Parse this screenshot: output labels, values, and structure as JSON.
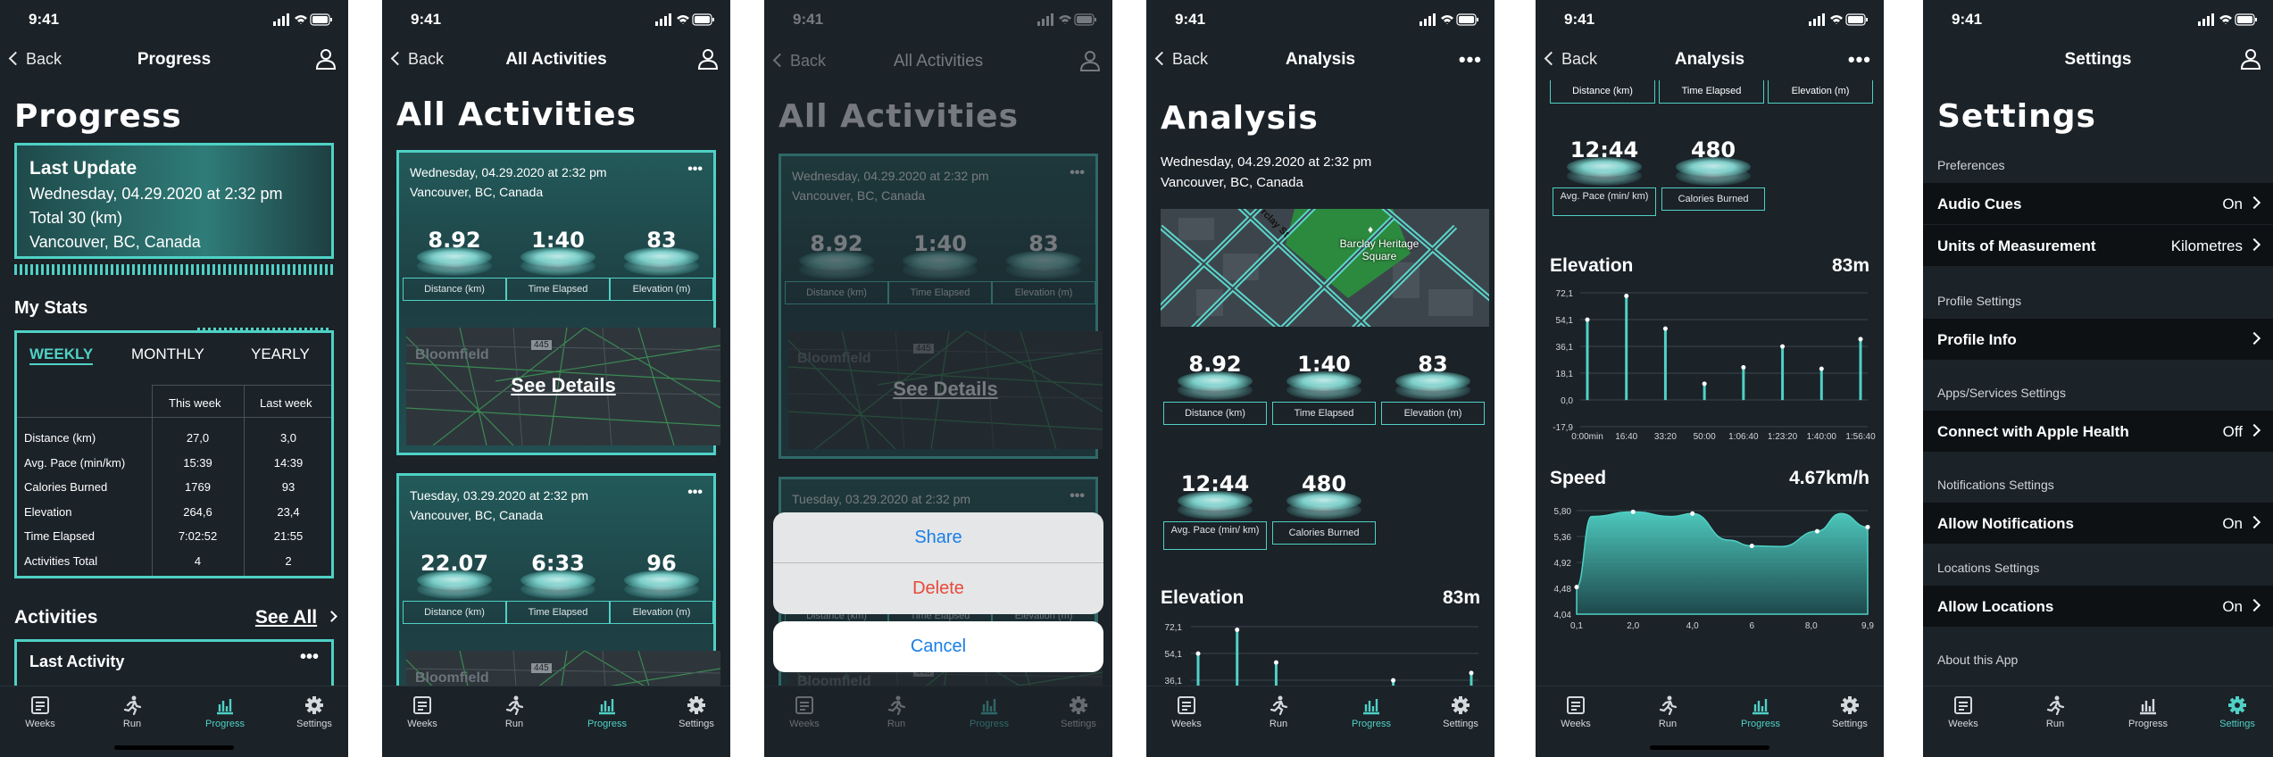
{
  "status_time": "9:41",
  "tabs": {
    "weeks": "Weeks",
    "run": "Run",
    "progress": "Progress",
    "settings": "Settings"
  },
  "colors": {
    "accent": "#4fd1c5",
    "bg": "#1b2228",
    "danger": "#e8493a",
    "ios_blue": "#1a7ee6"
  },
  "s1": {
    "back": "Back",
    "nav_title": "Progress",
    "title": "Progress",
    "last_update": {
      "heading": "Last Update",
      "date": "Wednesday, 04.29.2020 at 2:32 pm",
      "total": "Total 30 (km)",
      "location": "Vancouver, BC, Canada"
    },
    "my_stats": "My Stats",
    "periods": [
      "WEEKLY",
      "MONTHLY",
      "YEARLY"
    ],
    "cols": [
      "This week",
      "Last week"
    ],
    "rows": [
      {
        "label": "Distance (km)",
        "this": "27,0",
        "last": "3,0"
      },
      {
        "label": "Avg. Pace (min/km)",
        "this": "15:39",
        "last": "14:39"
      },
      {
        "label": "Calories Burned",
        "this": "1769",
        "last": "93"
      },
      {
        "label": "Elevation",
        "this": "264,6",
        "last": "23,4"
      },
      {
        "label": "Time Elapsed",
        "this": "7:02:52",
        "last": "21:55"
      },
      {
        "label": "Activities Total",
        "this": "4",
        "last": "2"
      }
    ],
    "activities": "Activities",
    "see_all": "See All",
    "last_activity": "Last Activity"
  },
  "s2": {
    "back": "Back",
    "nav_title": "All Activities",
    "title": "All Activities",
    "cards": [
      {
        "date": "Wednesday, 04.29.2020 at 2:32 pm",
        "location": "Vancouver, BC, Canada",
        "distance": "8.92",
        "time": "1:40",
        "elevation": "83"
      },
      {
        "date": "Tuesday, 03.29.2020 at 2:32 pm",
        "location": "Vancouver, BC, Canada",
        "distance": "22.07",
        "time": "6:33",
        "elevation": "96"
      }
    ],
    "labels": {
      "distance": "Distance (km)",
      "time": "Time Elapsed",
      "elevation": "Elevation (m)"
    },
    "see_details": "See Details",
    "map_place": "Bloomfield",
    "map_road": "445"
  },
  "s3": {
    "back": "Back",
    "nav_title": "All Activities",
    "title": "All Activities",
    "share": "Share",
    "delete": "Delete",
    "cancel": "Cancel"
  },
  "s4": {
    "back": "Back",
    "nav_title": "Analysis",
    "title": "Analysis",
    "date": "Wednesday, 04.29.2020 at 2:32 pm",
    "location": "Vancouver, BC, Canada",
    "map_label": "Barclay Heritage Square",
    "map_street": "rclay St",
    "stats": [
      {
        "value": "8.92",
        "label": "Distance (km)"
      },
      {
        "value": "1:40",
        "label": "Time Elapsed"
      },
      {
        "value": "83",
        "label": "Elevation (m)"
      },
      {
        "value": "12:44",
        "label": "Avg. Pace (min/ km)"
      },
      {
        "value": "480",
        "label": "Calories Burned"
      }
    ],
    "elevation_title": "Elevation",
    "elevation_value": "83m"
  },
  "s5": {
    "back": "Back",
    "nav_title": "Analysis",
    "top_labels": [
      "Distance (km)",
      "Time Elapsed",
      "Elevation (m)"
    ],
    "stats": [
      {
        "value": "12:44",
        "label": "Avg. Pace (min/ km)"
      },
      {
        "value": "480",
        "label": "Calories Burned"
      }
    ],
    "elevation_title": "Elevation",
    "elevation_value": "83m",
    "speed_title": "Speed",
    "speed_value": "4.67km/h"
  },
  "chart_data": [
    {
      "type": "bar",
      "title": "Elevation",
      "yticks": [
        "72,1",
        "54,1",
        "36,1",
        "18,1",
        "0,0",
        "-17,9"
      ],
      "ylim": [
        -17.9,
        72.1
      ],
      "categories": [
        "0:00min",
        "16:40",
        "33:20",
        "50:00",
        "1:06:40",
        "1:23:20",
        "1:40:00",
        "1:56:40"
      ],
      "values": [
        54,
        70,
        48,
        11,
        22,
        36,
        21,
        41
      ],
      "grid": true
    },
    {
      "type": "area",
      "title": "Speed",
      "yticks": [
        "5,80",
        "5,36",
        "4,92",
        "4,48",
        "4,04"
      ],
      "ylim": [
        4.04,
        5.8
      ],
      "xticks": [
        "0,1",
        "2,0",
        "4,0",
        "6",
        "8,0",
        "9,9"
      ],
      "x": [
        0.1,
        0.6,
        2.0,
        3.3,
        4.0,
        5.2,
        6.0,
        7.0,
        8.2,
        9.0,
        9.9
      ],
      "values": [
        4.5,
        5.7,
        5.78,
        5.7,
        5.75,
        5.3,
        5.2,
        5.19,
        5.45,
        5.75,
        5.52
      ],
      "grid": true
    }
  ],
  "s6": {
    "nav_title": "Settings",
    "title": "Settings",
    "sections": {
      "pref": "Preferences",
      "profile": "Profile Settings",
      "apps": "Apps/Services Settings",
      "notif": "Notifications Settings",
      "loc": "Locations Settings",
      "about": "About this App"
    },
    "rows": {
      "audio": {
        "name": "Audio Cues",
        "val": "On"
      },
      "units": {
        "name": "Units of Measurement",
        "val": "Kilometres"
      },
      "profile": {
        "name": "Profile Info",
        "val": ""
      },
      "health": {
        "name": "Connect with Apple Health",
        "val": "Off"
      },
      "notif": {
        "name": "Allow Notifications",
        "val": "On"
      },
      "loc": {
        "name": "Allow Locations",
        "val": "On"
      }
    }
  }
}
